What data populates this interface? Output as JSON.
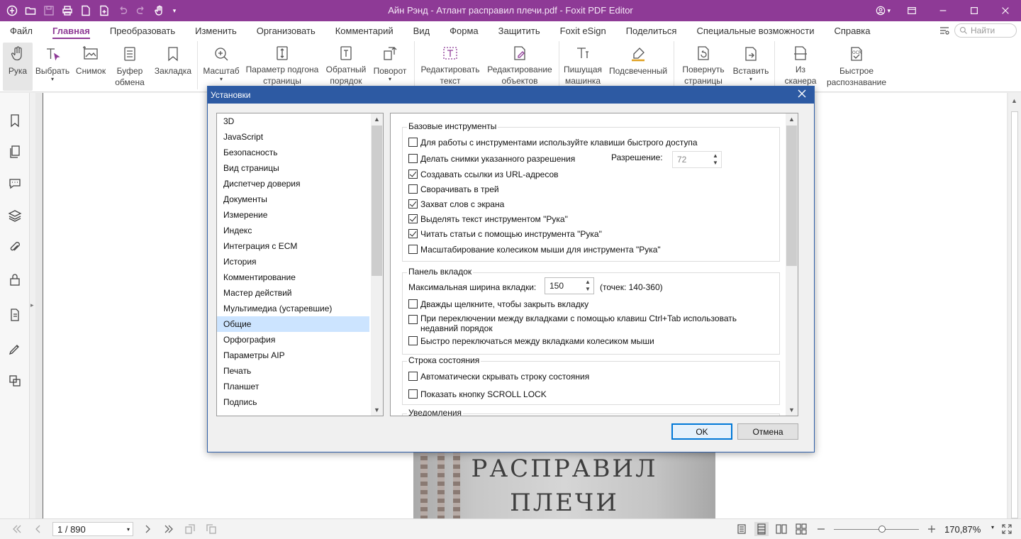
{
  "window": {
    "title": "Айн Рэнд - Атлант расправил плечи.pdf - Foxit PDF Editor"
  },
  "menu": {
    "items": [
      "Файл",
      "Главная",
      "Преобразовать",
      "Изменить",
      "Организовать",
      "Комментарий",
      "Вид",
      "Форма",
      "Защитить",
      "Foxit eSign",
      "Поделиться",
      "Специальные возможности",
      "Справка"
    ],
    "active": "Главная",
    "search_placeholder": "Найти"
  },
  "ribbon": {
    "hand": "Рука",
    "select": "Выбрать",
    "snapshot": "Снимок",
    "clipboard": "Буфер обмена",
    "bookmark": "Закладка",
    "zoom": "Масштаб",
    "fit": "Параметр подгона страницы",
    "reverse": "Обратный порядок",
    "rotate": "Поворот",
    "edit_text": "Редактировать текст",
    "edit_objects": "Редактирование объектов",
    "typewriter": "Пишущая машинка",
    "highlight": "Подсвеченный",
    "rotate_pages": "Повернуть страницы",
    "insert": "Вставить",
    "from_scanner": "Из сканера",
    "ocr": "Быстрое распознавание"
  },
  "cover": {
    "line1": "РАСПРАВИЛ",
    "line2": "ПЛЕЧИ"
  },
  "status": {
    "page": "1 / 890",
    "zoom": "170,87%",
    "zoom_level": 0.57
  },
  "dialog": {
    "title": "Установки",
    "categories": [
      "3D",
      "JavaScript",
      "Безопасность",
      "Вид страницы",
      "Диспетчер доверия",
      "Документы",
      "Измерение",
      "Индекс",
      "Интеграция с ECM",
      "История",
      "Комментирование",
      "Мастер действий",
      "Мультимедиа (устаревшие)",
      "Общие",
      "Орфография",
      "Параметры AIP",
      "Печать",
      "Планшет",
      "Подпись"
    ],
    "selected_category": "Общие",
    "basic": {
      "title": "Базовые инструменты",
      "opt1": "Для работы с инструментами используйте клавиши быстрого доступа",
      "opt2": "Делать снимки указанного разрешения",
      "resolution_label": "Разрешение:",
      "resolution_value": "72",
      "opt3": "Создавать ссылки из URL-адресов",
      "opt4": "Сворачивать в трей",
      "opt5": "Захват слов с экрана",
      "opt6": "Выделять текст инструментом \"Рука\"",
      "opt7": "Читать статьи с помощью инструмента \"Рука\"",
      "opt8": "Масштабирование колесиком мыши для инструмента \"Рука\"",
      "checked": [
        false,
        false,
        true,
        false,
        true,
        true,
        true,
        false
      ]
    },
    "tabs": {
      "title": "Панель вкладок",
      "max_width_label": "Максимальная ширина вкладки:",
      "max_width_value": "150",
      "range_hint": "(точек: 140-360)",
      "opt1": "Дважды щелкните, чтобы закрыть вкладку",
      "opt2": "При переключении между вкладками с помощью клавиш Ctrl+Tab использовать недавний порядок",
      "opt3": "Быстро переключаться между вкладками колесиком мыши",
      "checked": [
        false,
        false,
        false
      ]
    },
    "statusbar": {
      "title": "Строка состояния",
      "opt1": "Автоматически скрывать строку состояния",
      "opt2": "Показать кнопку SCROLL LOCK",
      "checked": [
        false,
        false
      ]
    },
    "notifications": {
      "title": "Уведомления"
    },
    "ok": "OK",
    "cancel": "Отмена"
  }
}
